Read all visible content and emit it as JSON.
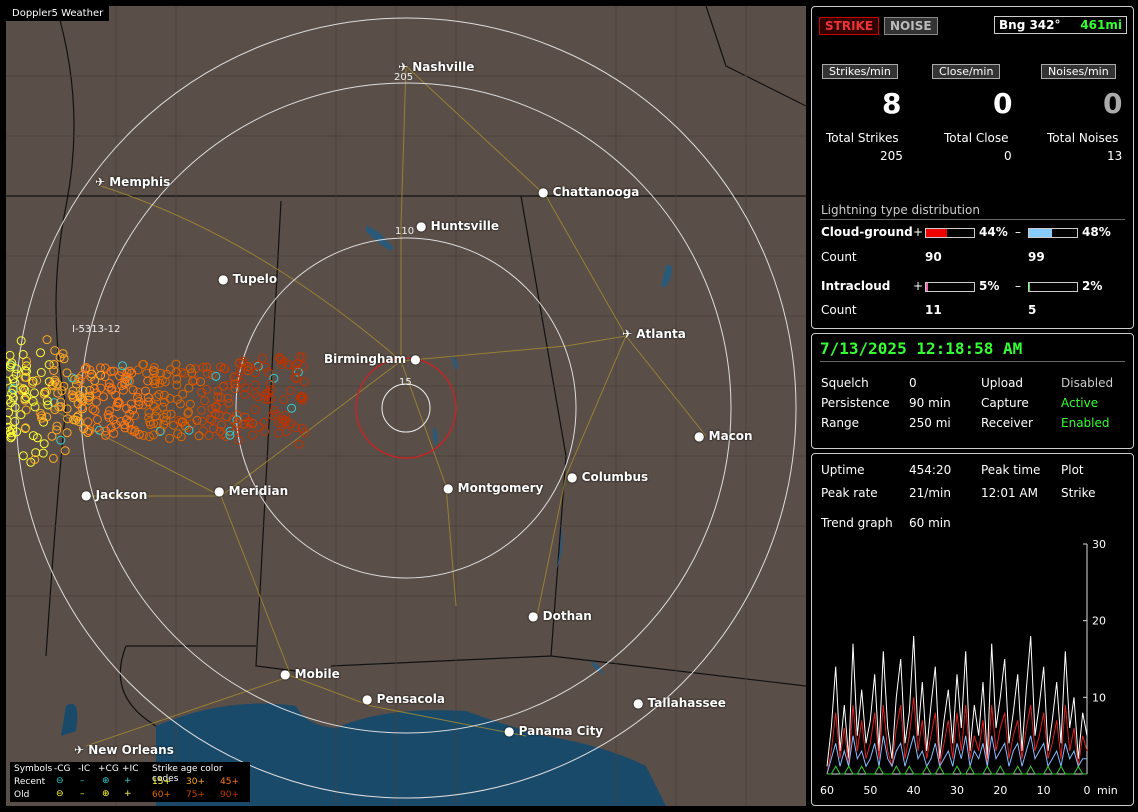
{
  "map": {
    "title": "Doppler5 Weather",
    "cities": [
      {
        "name": "Nashville"
      },
      {
        "name": "Memphis"
      },
      {
        "name": "Chattanooga"
      },
      {
        "name": "Huntsville"
      },
      {
        "name": "Tupelo"
      },
      {
        "name": "Atlanta"
      },
      {
        "name": "Birmingham"
      },
      {
        "name": "Macon"
      },
      {
        "name": "Jackson"
      },
      {
        "name": "Meridian"
      },
      {
        "name": "Montgomery"
      },
      {
        "name": "Columbus"
      },
      {
        "name": "Dothan"
      },
      {
        "name": "Mobile"
      },
      {
        "name": "Pensacola"
      },
      {
        "name": "Tallahassee"
      },
      {
        "name": "Panama City"
      },
      {
        "name": "New Orleans"
      }
    ],
    "ring_labels": [
      "205",
      "110",
      "15"
    ],
    "highway_label": "I-5313-12",
    "legend": {
      "symbols": "Symbols",
      "cols": [
        "-CG",
        "-IC",
        "+CG",
        "+IC"
      ],
      "age_title": "Strike age color codes",
      "recent": "Recent",
      "old": "Old",
      "recent_ages": [
        "15+",
        "30+",
        "45+"
      ],
      "old_ages": [
        "60+",
        "75+",
        "90+"
      ],
      "age_colors": [
        "#ffff33",
        "#ffaa22",
        "#ff7711",
        "#dd6600",
        "#cc4400",
        "#bb3300"
      ]
    }
  },
  "status": {
    "strike_btn": "STRIKE",
    "noise_btn": "NOISE",
    "bearing": "Bng 342°",
    "distance": "461mi",
    "headers": [
      "Strikes/min",
      "Close/min",
      "Noises/min"
    ],
    "rates": [
      "8",
      "0",
      "0"
    ],
    "totals_labels": [
      "Total Strikes",
      "Total Close",
      "Total Noises"
    ],
    "totals": [
      "205",
      "0",
      "13"
    ],
    "dist_title": "Lightning type distribution",
    "cg_label": "Cloud-ground",
    "cg_pos_pct": "44%",
    "cg_neg_pct": "48%",
    "cg_pos_fill": 0.44,
    "cg_neg_fill": 0.48,
    "count_label": "Count",
    "cg_pos_count": "90",
    "cg_neg_count": "99",
    "ic_label": "Intracloud",
    "ic_pos_pct": "5%",
    "ic_neg_pct": "2%",
    "ic_pos_fill": 0.05,
    "ic_neg_fill": 0.02,
    "ic_pos_count": "11",
    "ic_neg_count": "5",
    "plus": "+",
    "minus": "–"
  },
  "info": {
    "datetime": "7/13/2025 12:18:58 AM",
    "rows": [
      [
        "Squelch",
        "0",
        "Upload",
        "Disabled"
      ],
      [
        "Persistence",
        "90 min",
        "Capture",
        "Active"
      ],
      [
        "Range",
        "250 mi",
        "Receiver",
        "Enabled"
      ]
    ]
  },
  "stats": {
    "uptime_label": "Uptime",
    "uptime": "454:20",
    "peak_time_label": "Peak time",
    "plot_label": "Plot",
    "peak_rate_label": "Peak rate",
    "peak_rate": "21/min",
    "peak_time": "12:01 AM",
    "plot": "Strike",
    "trend_label": "Trend graph",
    "trend": "60 min",
    "y_ticks": [
      "30",
      "20",
      "10"
    ],
    "x_ticks": [
      "60",
      "50",
      "40",
      "30",
      "20",
      "10",
      "0"
    ],
    "x_unit": "min"
  },
  "chart_data": {
    "type": "line",
    "x": [
      60,
      59,
      58,
      57,
      56,
      55,
      54,
      53,
      52,
      51,
      50,
      49,
      48,
      47,
      46,
      45,
      44,
      43,
      42,
      41,
      40,
      39,
      38,
      37,
      36,
      35,
      34,
      33,
      32,
      31,
      30,
      29,
      28,
      27,
      26,
      25,
      24,
      23,
      22,
      21,
      20,
      19,
      18,
      17,
      16,
      15,
      14,
      13,
      12,
      11,
      10,
      9,
      8,
      7,
      6,
      5,
      4,
      3,
      2,
      1,
      0
    ],
    "ylim": [
      0,
      30
    ],
    "series": [
      {
        "color": "#ffffff",
        "values": [
          1,
          6,
          14,
          3,
          9,
          2,
          17,
          5,
          11,
          4,
          7,
          13,
          3,
          16,
          6,
          2,
          10,
          15,
          4,
          8,
          18,
          5,
          12,
          3,
          9,
          14,
          2,
          7,
          11,
          4,
          13,
          6,
          16,
          3,
          9,
          5,
          12,
          2,
          17,
          6,
          10,
          15,
          4,
          8,
          13,
          3,
          11,
          18,
          5,
          9,
          14,
          3,
          7,
          12,
          4,
          16,
          6,
          10,
          2,
          8,
          5
        ]
      },
      {
        "color": "#dd2222",
        "values": [
          0,
          3,
          8,
          2,
          6,
          1,
          9,
          3,
          7,
          2,
          4,
          8,
          2,
          9,
          3,
          1,
          6,
          9,
          2,
          5,
          10,
          3,
          7,
          2,
          5,
          8,
          1,
          4,
          7,
          2,
          8,
          3,
          9,
          2,
          5,
          3,
          7,
          1,
          9,
          3,
          6,
          8,
          2,
          5,
          7,
          2,
          6,
          9,
          3,
          5,
          8,
          2,
          4,
          7,
          2,
          9,
          3,
          6,
          1,
          5,
          3
        ]
      },
      {
        "color": "#88bbff",
        "values": [
          0,
          2,
          4,
          1,
          3,
          1,
          5,
          2,
          3,
          1,
          2,
          4,
          1,
          5,
          2,
          1,
          3,
          4,
          1,
          3,
          5,
          2,
          3,
          1,
          2,
          4,
          1,
          2,
          3,
          1,
          4,
          2,
          5,
          1,
          3,
          2,
          4,
          1,
          5,
          2,
          3,
          4,
          1,
          3,
          4,
          1,
          3,
          5,
          2,
          3,
          4,
          1,
          2,
          3,
          1,
          4,
          2,
          3,
          1,
          2,
          2
        ]
      },
      {
        "color": "#33cc33",
        "values": [
          0,
          0,
          1,
          0,
          0,
          1,
          0,
          0,
          1,
          0,
          0,
          0,
          1,
          0,
          0,
          0,
          1,
          0,
          0,
          1,
          0,
          0,
          0,
          1,
          0,
          0,
          1,
          0,
          0,
          0,
          1,
          0,
          0,
          1,
          0,
          0,
          0,
          1,
          0,
          0,
          1,
          0,
          0,
          0,
          1,
          0,
          0,
          1,
          0,
          0,
          0,
          1,
          0,
          0,
          1,
          0,
          0,
          0,
          1,
          0,
          0
        ]
      }
    ]
  }
}
